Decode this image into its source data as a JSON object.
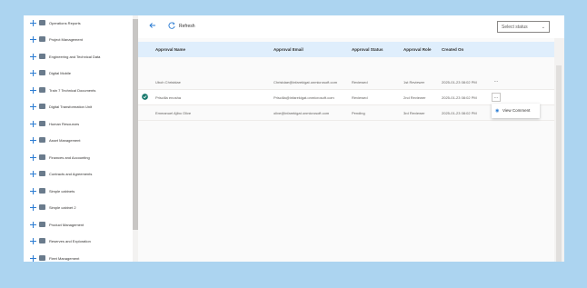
{
  "sidebar": {
    "items": [
      {
        "label": "Operations Reports"
      },
      {
        "label": "Project Management"
      },
      {
        "label": "Engineering and Technical Data"
      },
      {
        "label": "Digital Mobile"
      },
      {
        "label": "Train 7 Technical Documents"
      },
      {
        "label": "Digital Transformation Unit"
      },
      {
        "label": "Human Resources"
      },
      {
        "label": "Asset Management"
      },
      {
        "label": "Finances and Accounting"
      },
      {
        "label": "Contracts and Agreements"
      },
      {
        "label": "Simple cabinets"
      },
      {
        "label": "Simple cabinet 2"
      },
      {
        "label": "Product Management"
      },
      {
        "label": "Reserves and Exploration"
      },
      {
        "label": "Fleet Management"
      }
    ]
  },
  "toolbar": {
    "refresh_label": "Refresh",
    "status_placeholder": "Select status"
  },
  "grid": {
    "columns": [
      "Approval Name",
      "Approval Email",
      "Approval Status",
      "Approval Role",
      "Created On"
    ],
    "rows": [
      {
        "name": "Uboh Christdae",
        "email": "Christdae@infarekigat.onmicrosoft.com",
        "status": "Reviewed",
        "role": "1st Reviewer",
        "created": "2025-01-23 08:02 PM",
        "selected": false
      },
      {
        "name": "Priscilla enosha",
        "email": "Priscilla@infarekigat.onmicrosoft.com",
        "status": "Reviewed",
        "role": "2nd Reviewer",
        "created": "2025-01-23 08:02 PM",
        "selected": true
      },
      {
        "name": "Emmanuel Ajibo Olive",
        "email": "olive@infarekigat.onmicrosoft.com",
        "status": "Pending",
        "role": "3rd Reviewer",
        "created": "2025-01-23 08:02 PM",
        "selected": false
      }
    ],
    "more_label": "..."
  },
  "context_menu": {
    "view_comment_label": "View Comment"
  },
  "colors": {
    "accent": "#2b7cd3",
    "header_bg": "#dfeefc",
    "page_bg": "#acd4f0",
    "check": "#1a7a6e"
  }
}
